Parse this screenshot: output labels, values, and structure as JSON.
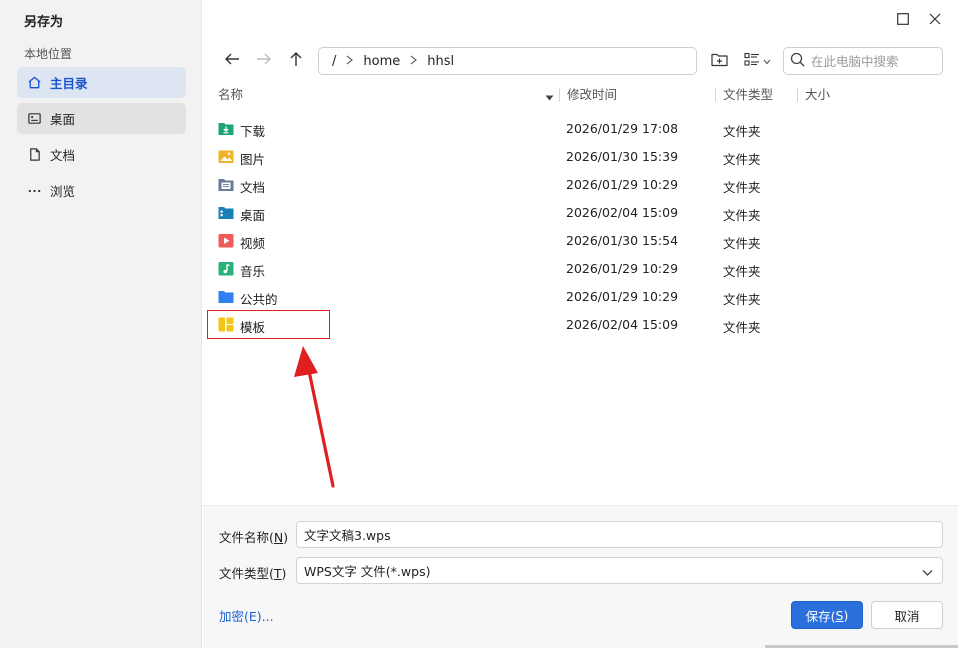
{
  "dialog": {
    "title": "另存为"
  },
  "window_controls": {
    "maximize": "maximize-icon",
    "close": "close-icon"
  },
  "sidebar": {
    "section_label": "本地位置",
    "items": [
      {
        "label": "主目录",
        "icon": "home-icon",
        "state": "selected"
      },
      {
        "label": "桌面",
        "icon": "desktop-icon",
        "state": "hover"
      },
      {
        "label": "文档",
        "icon": "document-icon",
        "state": "normal"
      },
      {
        "label": "浏览",
        "icon": "more-icon",
        "state": "normal"
      }
    ]
  },
  "toolbar": {
    "path": [
      "/",
      "home",
      "hhsl"
    ],
    "search_placeholder": "在此电脑中搜索"
  },
  "columns": {
    "name": "名称",
    "modified": "修改时间",
    "type": "文件类型",
    "size": "大小"
  },
  "files": [
    {
      "name": "下载",
      "modified": "2026/01/29 17:08",
      "type": "文件夹",
      "icon": "download-folder-icon",
      "color": "#1fa37a"
    },
    {
      "name": "图片",
      "modified": "2026/01/30 15:39",
      "type": "文件夹",
      "icon": "pictures-folder-icon",
      "color": "#f0b429"
    },
    {
      "name": "文档",
      "modified": "2026/01/29 10:29",
      "type": "文件夹",
      "icon": "documents-folder-icon",
      "color": "#6b7a99"
    },
    {
      "name": "桌面",
      "modified": "2026/02/04 15:09",
      "type": "文件夹",
      "icon": "desktop-folder-icon",
      "color": "#1a7fb5"
    },
    {
      "name": "视频",
      "modified": "2026/01/30 15:54",
      "type": "文件夹",
      "icon": "videos-folder-icon",
      "color": "#ef5a5a"
    },
    {
      "name": "音乐",
      "modified": "2026/01/29 10:29",
      "type": "文件夹",
      "icon": "music-folder-icon",
      "color": "#2bb07a"
    },
    {
      "name": "公共的",
      "modified": "2026/01/29 10:29",
      "type": "文件夹",
      "icon": "public-folder-icon",
      "color": "#2f80ed"
    },
    {
      "name": "模板",
      "modified": "2026/02/04 15:09",
      "type": "文件夹",
      "icon": "templates-folder-icon",
      "color": "#f5c518"
    }
  ],
  "annotation": {
    "highlight_color": "#e02020"
  },
  "form": {
    "filename_label": "文件名称(",
    "filename_hotkey": "N",
    "filename_label_end": ")",
    "filename_value": "文字文稿3.wps",
    "filetype_label": "文件类型(",
    "filetype_hotkey": "T",
    "filetype_label_end": ")",
    "filetype_value": "WPS文字 文件(*.wps)",
    "encrypt_link": "加密(E)...",
    "save_label": "保存(",
    "save_hotkey": "S",
    "save_label_end": ")",
    "cancel_label": "取消"
  },
  "colors": {
    "accent": "#2a6fdb",
    "selected_bg": "#dde5f3",
    "link": "#1a5fd1"
  }
}
